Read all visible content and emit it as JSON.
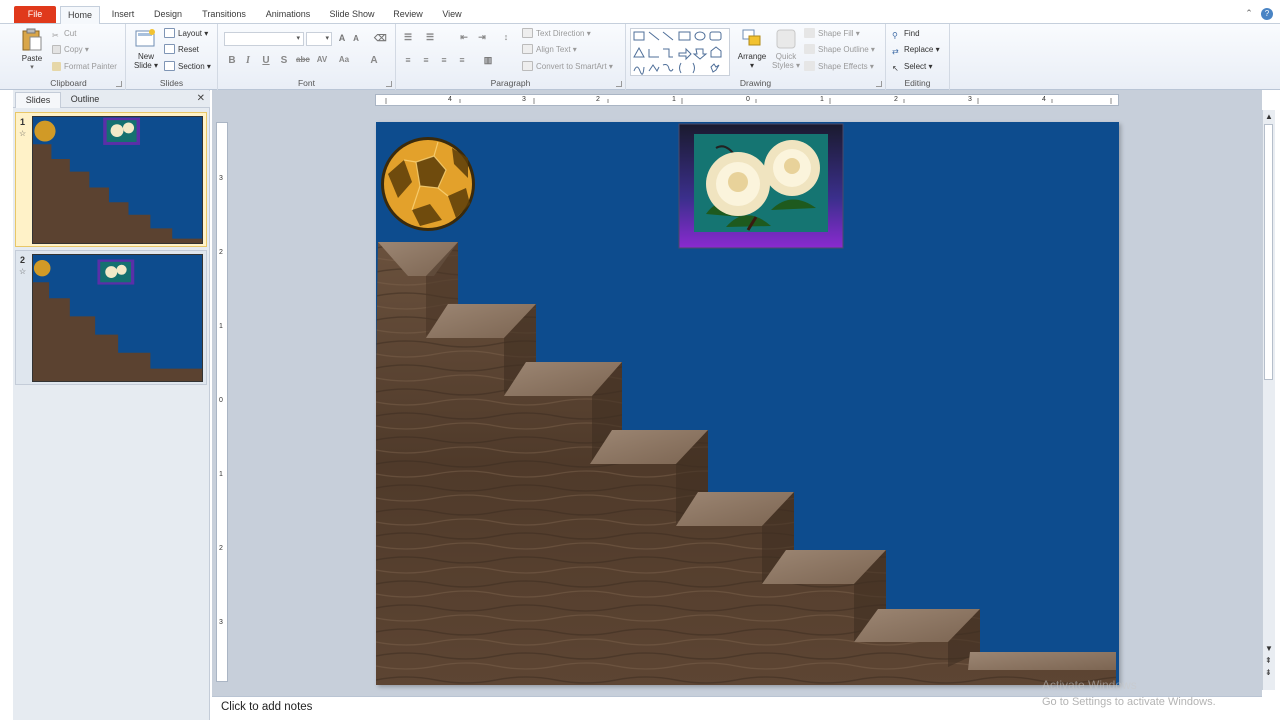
{
  "tabs": [
    "File",
    "Home",
    "Insert",
    "Design",
    "Transitions",
    "Animations",
    "Slide Show",
    "Review",
    "View"
  ],
  "clipboard": {
    "paste": "Paste",
    "cut": "Cut",
    "copy": "Copy",
    "format_painter": "Format Painter",
    "label": "Clipboard"
  },
  "slides_group": {
    "new_slide": "New",
    "new_slide2": "Slide",
    "layout": "Layout",
    "reset": "Reset",
    "section": "Section",
    "label": "Slides"
  },
  "font_group": {
    "label": "Font"
  },
  "paragraph_group": {
    "text_direction": "Text Direction",
    "align_text": "Align Text",
    "convert": "Convert to SmartArt",
    "label": "Paragraph"
  },
  "drawing_group": {
    "arrange": "Arrange",
    "quick": "Quick",
    "styles": "Styles",
    "shape_fill": "Shape Fill",
    "shape_outline": "Shape Outline",
    "shape_effects": "Shape Effects",
    "label": "Drawing"
  },
  "editing_group": {
    "find": "Find",
    "replace": "Replace",
    "select": "Select",
    "label": "Editing"
  },
  "panel": {
    "tab_slides": "Slides",
    "tab_outline": "Outline",
    "slide1": "1",
    "slide2": "2"
  },
  "hruler": [
    "4",
    "3",
    "2",
    "1",
    "0",
    "1",
    "2",
    "3",
    "4"
  ],
  "vruler": [
    "3",
    "2",
    "1",
    "0",
    "1",
    "2",
    "3"
  ],
  "notes": "Click to add notes",
  "watermark": {
    "line1": "Activate Windows",
    "line2": "Go to Settings to activate Windows."
  },
  "colors": {
    "slide_bg": "#0d4c8e",
    "file_tab": "#e0391b"
  }
}
